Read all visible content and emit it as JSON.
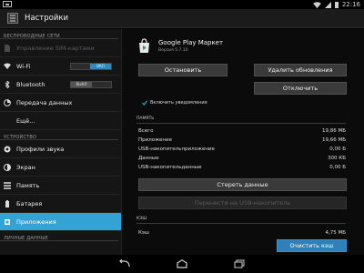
{
  "status_bar": {
    "time": "22:16",
    "icons": [
      "notification-icon",
      "wifi-icon",
      "signal-icon",
      "battery-icon"
    ]
  },
  "action_bar": {
    "title": "Настройки",
    "icon": "settings-app-icon"
  },
  "sidebar": {
    "sections": [
      "БЕСПРОВОДНЫЕ СЕТИ",
      "УСТРОЙСТВО",
      "ЛИЧНЫЕ ДАННЫЕ"
    ],
    "items": [
      {
        "label": "Управление SIM-картами",
        "icon": "sim-icon"
      },
      {
        "label": "Wi-Fi",
        "icon": "wifi-icon",
        "toggle": "ВКЛ"
      },
      {
        "label": "Bluetooth",
        "icon": "bluetooth-icon",
        "toggle": "ВЫКЛ"
      },
      {
        "label": "Передача данных",
        "icon": "data-usage-icon"
      },
      {
        "label": "Ещё...",
        "icon": ""
      },
      {
        "label": "Профили звука",
        "icon": "sound-icon"
      },
      {
        "label": "Экран",
        "icon": "display-icon"
      },
      {
        "label": "Память",
        "icon": "storage-icon"
      },
      {
        "label": "Батарея",
        "icon": "battery-icon"
      },
      {
        "label": "Приложения",
        "icon": "apps-icon"
      }
    ]
  },
  "app_info": {
    "name": "Google Play Маркет",
    "version": "Версия 5.7.10",
    "buttons": {
      "stop": "Остановить",
      "uninstall_updates": "Удалить обновления",
      "disable": "Отключить"
    },
    "notifications_label": "Включить уведомления"
  },
  "memory": {
    "title": "ПАМЯТЬ",
    "rows": [
      {
        "label": "Всего",
        "value": "19,86 МБ"
      },
      {
        "label": "Приложение",
        "value": "19,66 МБ"
      },
      {
        "label": "USB-накопительприложение",
        "value": "0,00 Б"
      },
      {
        "label": "Данные",
        "value": "300 КБ"
      },
      {
        "label": "USB-накопительданные",
        "value": "0,00 Б"
      }
    ],
    "clear_data_button": "Стереть данные",
    "move_usb_button": "Перенести на USB-накопитель"
  },
  "cache": {
    "title": "КЭШ",
    "label": "Кэш",
    "value": "4,75 МБ",
    "clear_cache_button": "Очистить кэш"
  },
  "colors": {
    "accent": "#33a3d6",
    "toggle_on": "#2f8ac2"
  }
}
